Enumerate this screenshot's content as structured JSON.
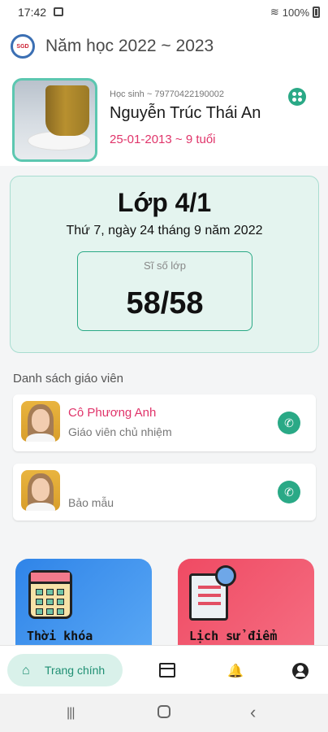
{
  "status_bar": {
    "time": "17:42",
    "battery": "100%"
  },
  "header": {
    "logo_text": "SGD",
    "title": "Năm học 2022 ~ 2023"
  },
  "student": {
    "id_line": "Học sinh ~ 79770422190002",
    "name": "Nguyễn Trúc Thái An",
    "dob_line": "25-01-2013 ~ 9 tuổi"
  },
  "class_card": {
    "class_name": "Lớp 4/1",
    "date_line": "Thứ 7, ngày 24 tháng 9 năm 2022",
    "size_label": "Sĩ số lớp",
    "size_value": "58/58"
  },
  "teachers_section": {
    "title": "Danh sách giáo viên",
    "teachers": [
      {
        "name": "Cô Phương Anh",
        "role": "Giáo viên chủ nhiệm"
      },
      {
        "name": "",
        "role": "Bảo mẫu"
      }
    ]
  },
  "tiles": [
    {
      "label": "Thời khóa"
    },
    {
      "label": "Lịch sử điểm"
    }
  ],
  "bottom_nav": {
    "home_label": "Trang chính"
  },
  "colors": {
    "accent": "#2aa986",
    "pink": "#e0346a",
    "card_bg": "#e4f4ef"
  }
}
